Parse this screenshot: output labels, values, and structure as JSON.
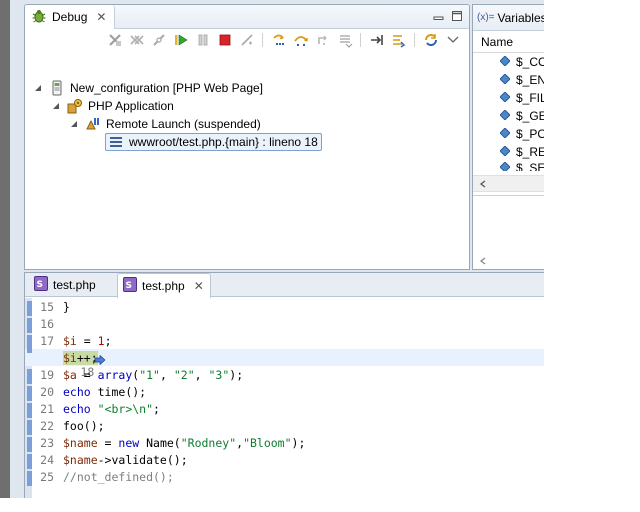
{
  "debug_view": {
    "tab_label": "Debug",
    "tree": {
      "root": "New_configuration [PHP Web Page]",
      "app": "PHP Application",
      "launch": "Remote Launch (suspended)",
      "frame": "wwwroot/test.php.{main} : lineno 18"
    },
    "toolbar_icons": [
      "remove-launch-icon",
      "remove-all-icon",
      "disconnect-icon",
      "resume-icon",
      "suspend-icon",
      "terminate-icon",
      "disconnect-all-icon",
      "step-into-icon",
      "step-over-icon",
      "step-return-icon",
      "drop-to-frame-icon",
      "use-step-filters-icon",
      "step-with-filters-icon",
      "refresh-icon",
      "view-menu-icon"
    ]
  },
  "variables_view": {
    "tab_label": "Variables",
    "tab_prefix": "(x)=",
    "column_name": "Name",
    "rows": [
      "$_CO",
      "$_EN",
      "$_FIL",
      "$_GE",
      "$_PO",
      "$_RE",
      "$_SEF"
    ]
  },
  "editor": {
    "tabs": [
      {
        "label": "test.php",
        "active": false
      },
      {
        "label": "test.php",
        "active": true
      }
    ],
    "current_line": 18,
    "lines": [
      {
        "no": "15",
        "text": "}"
      },
      {
        "no": "16",
        "text": ""
      },
      {
        "no": "17",
        "text": "$i = 1;"
      },
      {
        "no": "18",
        "text": "$i++;"
      },
      {
        "no": "19",
        "text": "$a = array(\"1\", \"2\", \"3\");"
      },
      {
        "no": "20",
        "text": "echo time();"
      },
      {
        "no": "21",
        "text": "echo \"<br>\\n\";"
      },
      {
        "no": "22",
        "text": "foo();"
      },
      {
        "no": "23",
        "text": "$name = new Name(\"Rodney\",\"Bloom\");"
      },
      {
        "no": "24",
        "text": "$name->validate();"
      },
      {
        "no": "25",
        "text": "//not_defined();"
      }
    ]
  },
  "colors": {
    "view_border": "#99a8b9",
    "current_line_bg": "#e8f2fe",
    "current_stmt_bg": "#c7dba3",
    "keyword": "#0000c0",
    "string": "#0d7d2e",
    "number": "#c00000"
  }
}
